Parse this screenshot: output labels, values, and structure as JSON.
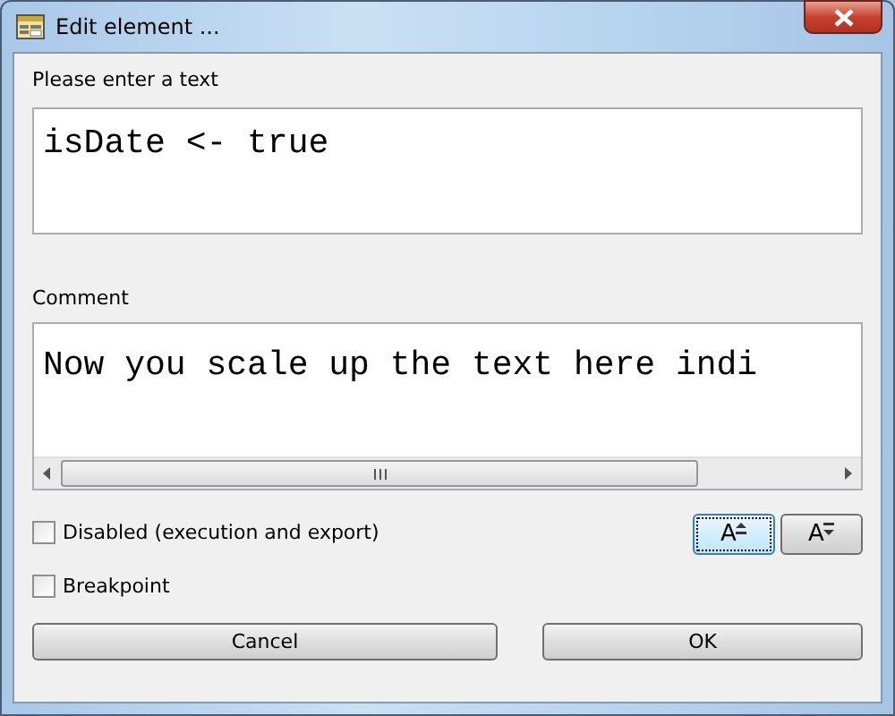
{
  "window": {
    "title": "Edit element ..."
  },
  "text_field": {
    "label": "Please enter a text",
    "value": "isDate <- true"
  },
  "comment_field": {
    "label": "Comment",
    "value": "Now you scale up the text here indi"
  },
  "checkboxes": [
    {
      "label": "Disabled (execution and export)",
      "checked": false
    },
    {
      "label": "Breakpoint",
      "checked": false
    }
  ],
  "font_buttons": [
    {
      "label": "A",
      "kind": "increase",
      "focused": true
    },
    {
      "label": "A",
      "kind": "decrease",
      "focused": false
    }
  ],
  "buttons": [
    "Cancel",
    "OK"
  ]
}
